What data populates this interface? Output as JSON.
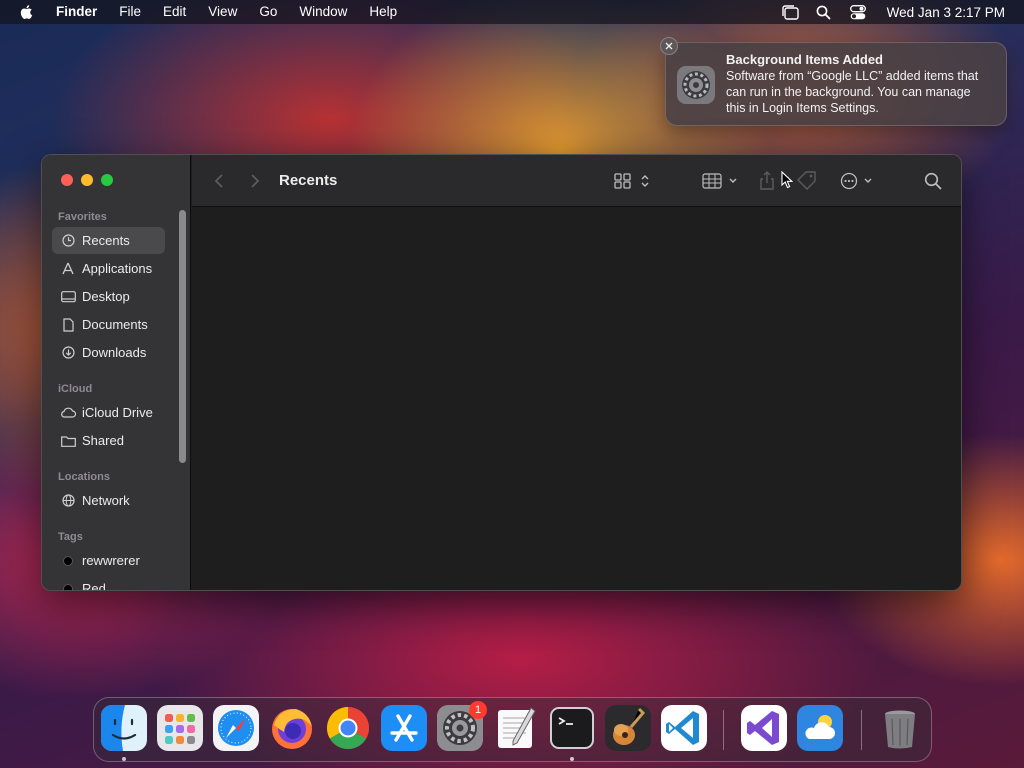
{
  "menubar": {
    "app_name": "Finder",
    "items": [
      "File",
      "Edit",
      "View",
      "Go",
      "Window",
      "Help"
    ],
    "clock": "Wed Jan 3  2:17 PM"
  },
  "notification": {
    "title": "Background Items Added",
    "body": "Software from “Google LLC” added items that can run in the background. You can manage this in Login Items Settings."
  },
  "finder": {
    "title": "Recents",
    "sections": {
      "favorites": "Favorites",
      "icloud": "iCloud",
      "locations": "Locations",
      "tags": "Tags"
    },
    "favorites": [
      "Recents",
      "Applications",
      "Desktop",
      "Documents",
      "Downloads"
    ],
    "icloud": [
      "iCloud Drive",
      "Shared"
    ],
    "locations": [
      "Network"
    ],
    "tags": [
      "rewwrerer",
      "Red"
    ]
  },
  "dock": {
    "apps": [
      "Finder",
      "Launchpad",
      "Safari",
      "Firefox",
      "Google Chrome",
      "App Store",
      "System Settings",
      "TextEdit",
      "Terminal",
      "GarageBand",
      "Visual Studio Code",
      "Visual Studio",
      "Weather",
      "Trash"
    ],
    "system_settings_badge": "1"
  },
  "colors": {
    "close": "#ff5f57",
    "minimize": "#febc2e",
    "maximize": "#28c840",
    "badge": "#ff3b30"
  }
}
